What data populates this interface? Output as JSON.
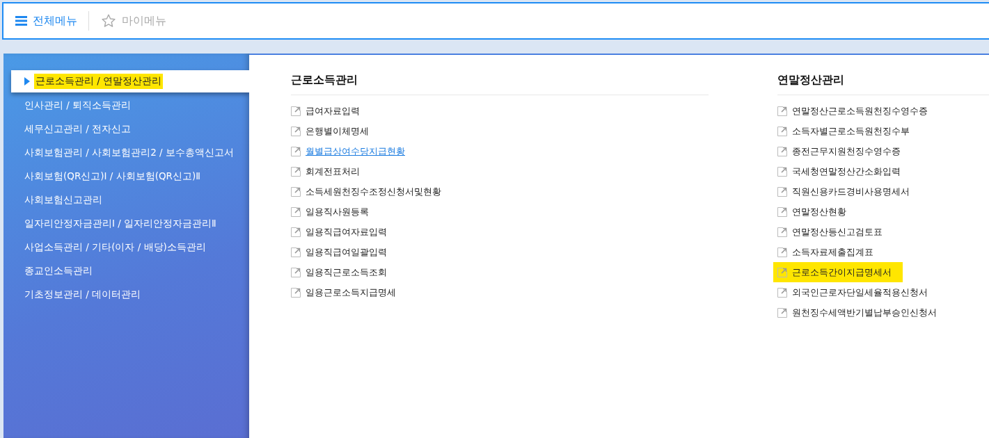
{
  "tabs": [
    {
      "label": "전체메뉴",
      "kind": "menu",
      "selected": true
    },
    {
      "label": "마이메뉴",
      "kind": "star",
      "selected": false
    }
  ],
  "sidebar": {
    "items": [
      {
        "label": "근로소득관리 / 연말정산관리",
        "selected": true
      },
      {
        "label": "인사관리 / 퇴직소득관리",
        "selected": false
      },
      {
        "label": "세무신고관리 / 전자신고",
        "selected": false
      },
      {
        "label": "사회보험관리 / 사회보험관리2 / 보수총액신고서",
        "selected": false
      },
      {
        "label": "사회보험(QR신고)Ⅰ / 사회보험(QR신고)Ⅱ",
        "selected": false
      },
      {
        "label": "사회보험신고관리",
        "selected": false
      },
      {
        "label": "일자리안정자금관리Ⅰ / 일자리안정자금관리Ⅱ",
        "selected": false
      },
      {
        "label": "사업소득관리 / 기타(이자 / 배당)소득관리",
        "selected": false
      },
      {
        "label": "종교인소득관리",
        "selected": false
      },
      {
        "label": "기초정보관리 / 데이터관리",
        "selected": false
      }
    ]
  },
  "sections": [
    {
      "title": "근로소득관리",
      "items": [
        {
          "label": "급여자료입력",
          "hovered": false,
          "highlighted": false
        },
        {
          "label": "은행별이체명세",
          "hovered": false,
          "highlighted": false
        },
        {
          "label": "월별급상여수당지급현황",
          "hovered": true,
          "highlighted": false
        },
        {
          "label": "회계전표처리",
          "hovered": false,
          "highlighted": false
        },
        {
          "label": "소득세원천징수조정신청서및현황",
          "hovered": false,
          "highlighted": false
        },
        {
          "label": "일용직사원등록",
          "hovered": false,
          "highlighted": false
        },
        {
          "label": "일용직급여자료입력",
          "hovered": false,
          "highlighted": false
        },
        {
          "label": "일용직급여일괄입력",
          "hovered": false,
          "highlighted": false
        },
        {
          "label": "일용직근로소득조회",
          "hovered": false,
          "highlighted": false
        },
        {
          "label": "일용근로소득지급명세",
          "hovered": false,
          "highlighted": false
        }
      ]
    },
    {
      "title": "연말정산관리",
      "items": [
        {
          "label": "연말정산근로소득원천징수영수증",
          "hovered": false,
          "highlighted": false
        },
        {
          "label": "소득자별근로소득원천징수부",
          "hovered": false,
          "highlighted": false
        },
        {
          "label": "종전근무지원천징수영수증",
          "hovered": false,
          "highlighted": false
        },
        {
          "label": "국세청연말정산간소화입력",
          "hovered": false,
          "highlighted": false
        },
        {
          "label": "직원신용카드경비사용명세서",
          "hovered": false,
          "highlighted": false
        },
        {
          "label": "연말정산현황",
          "hovered": false,
          "highlighted": false
        },
        {
          "label": "연말정산등신고검토표",
          "hovered": false,
          "highlighted": false
        },
        {
          "label": "소득자료제출집계표",
          "hovered": false,
          "highlighted": false
        },
        {
          "label": "근로소득간이지급명세서",
          "hovered": false,
          "highlighted": true
        },
        {
          "label": "외국인근로자단일세율적용신청서",
          "hovered": false,
          "highlighted": false
        },
        {
          "label": "원천징수세액반기별납부승인신청서",
          "hovered": false,
          "highlighted": false
        }
      ]
    }
  ]
}
